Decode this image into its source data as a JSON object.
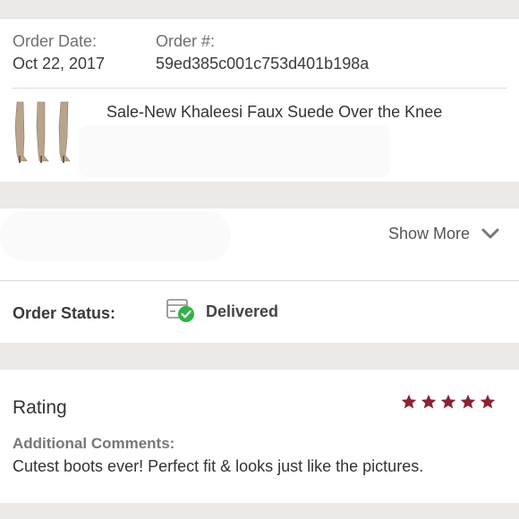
{
  "order": {
    "date_label": "Order Date:",
    "date_value": "Oct 22, 2017",
    "number_label": "Order #:",
    "number_value": "59ed385c001c753d401b198a",
    "item_title": "Sale-New Khaleesi Faux Suede Over the Knee"
  },
  "details": {
    "show_more_label": "Show More",
    "status_label": "Order Status:",
    "status_value": "Delivered"
  },
  "rating": {
    "title": "Rating",
    "stars": 5,
    "star_color": "#8b2332",
    "comments_label": "Additional Comments:",
    "comments_text": "Cutest boots ever! Perfect fit & looks just like the pictures."
  },
  "colors": {
    "page_bg": "#ece9e6",
    "card_bg": "#ffffff",
    "delivered_green": "#2eb34a"
  }
}
